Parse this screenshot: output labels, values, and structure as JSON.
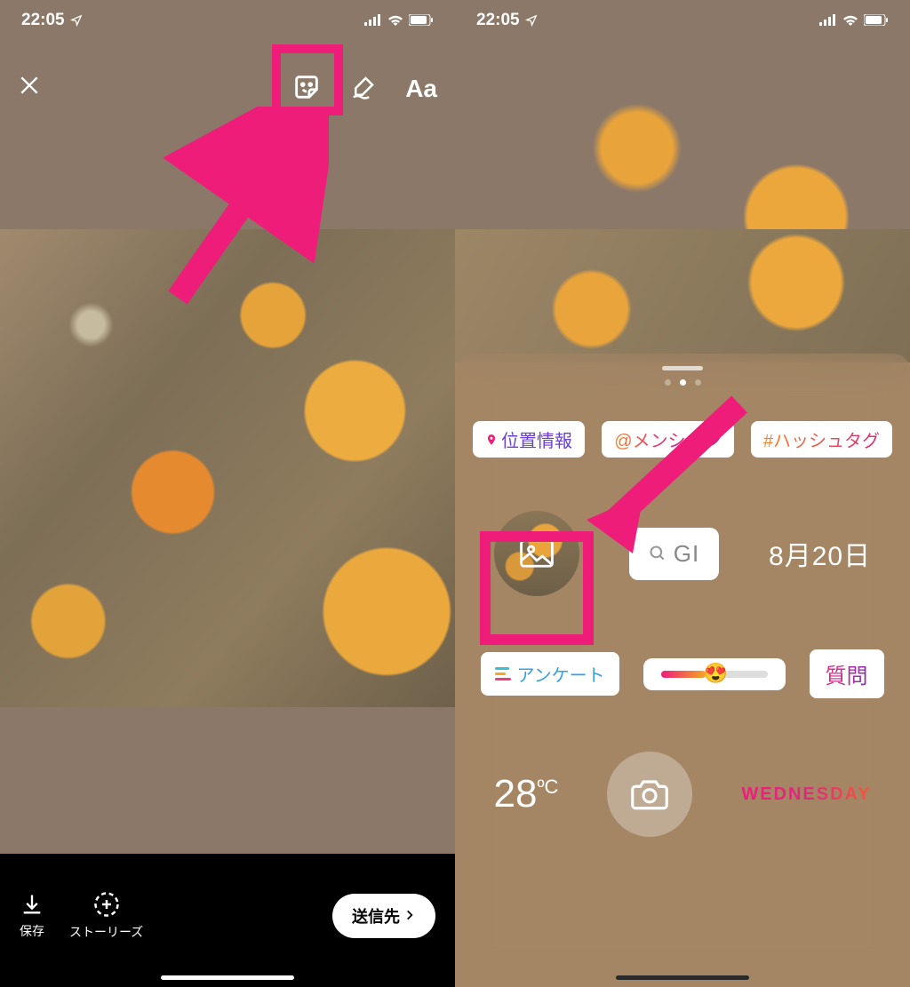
{
  "status": {
    "time": "22:05",
    "location_arrow": "↗"
  },
  "left": {
    "toolbar": {
      "text_tool": "Aa"
    },
    "bottom": {
      "save": "保存",
      "stories": "ストーリーズ",
      "send": "送信先"
    }
  },
  "right": {
    "stickers": {
      "location": "位置情報",
      "mention": "@メンション",
      "hashtag": "#ハッシュタグ",
      "gif": "GI",
      "date": "8月20日",
      "poll": "アンケート",
      "question": "質問",
      "temperature": "28",
      "temperature_unit": "ºC",
      "weekday": "WEDNESDAY"
    }
  },
  "annotation_color": "#ee1d7a"
}
